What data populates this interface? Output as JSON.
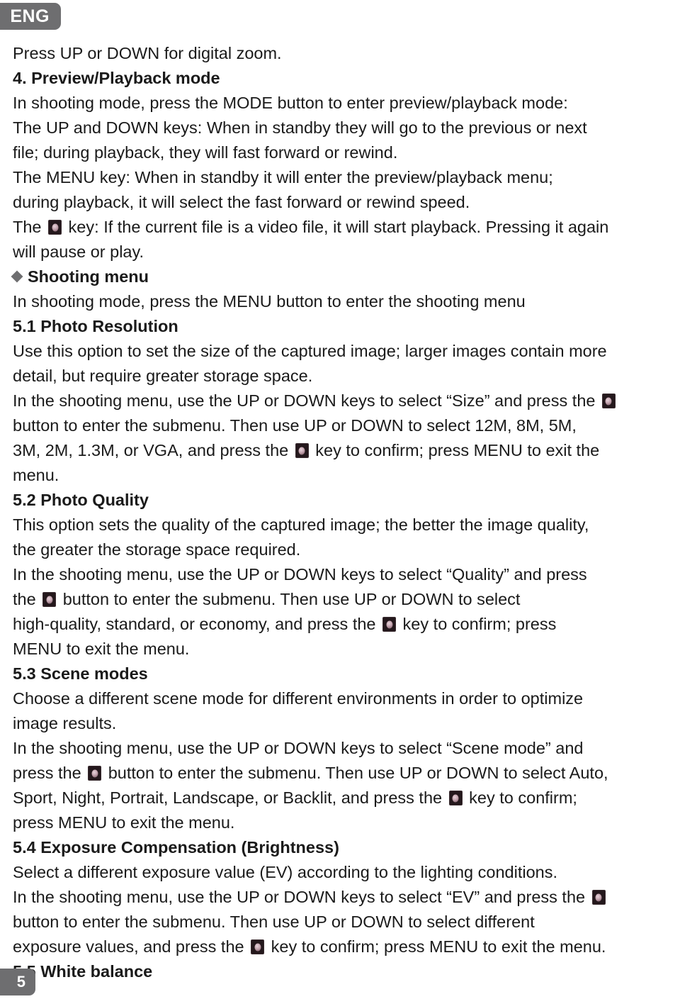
{
  "badges": {
    "language": "ENG",
    "page_number": "5",
    "badge_color": "#6e6e70",
    "badge_text_color": "#ffffff"
  },
  "icons": {
    "key_icon": "camera-shutter-key-icon",
    "bullet_icon": "diamond-bullet-icon"
  },
  "document": {
    "lines": [
      {
        "id": "l1",
        "bold": false,
        "segments": [
          {
            "t": "Press UP or DOWN for digital zoom."
          }
        ]
      },
      {
        "id": "l2",
        "bold": true,
        "segments": [
          {
            "t": "4. Preview/Playback mode"
          }
        ]
      },
      {
        "id": "l3",
        "bold": false,
        "segments": [
          {
            "t": "In shooting mode, press the MODE button to enter preview/playback mode:"
          }
        ]
      },
      {
        "id": "l4",
        "bold": false,
        "segments": [
          {
            "t": "The UP and DOWN keys: When in standby they will go to the previous or next"
          }
        ]
      },
      {
        "id": "l5",
        "bold": false,
        "segments": [
          {
            "t": "file; during playback, they will fast forward or rewind."
          }
        ]
      },
      {
        "id": "l6",
        "bold": false,
        "segments": [
          {
            "t": "The MENU key: When in standby it will enter the preview/playback menu;"
          }
        ]
      },
      {
        "id": "l7",
        "bold": false,
        "segments": [
          {
            "t": "during playback, it will select the fast forward or rewind speed."
          }
        ]
      },
      {
        "id": "l8",
        "bold": false,
        "segments": [
          {
            "t": "The "
          },
          {
            "icon": "key"
          },
          {
            "t": " key: If the current file is a video file, it will start playback. Pressing it again"
          }
        ]
      },
      {
        "id": "l9",
        "bold": false,
        "segments": [
          {
            "t": "will pause or play."
          }
        ]
      },
      {
        "id": "l10",
        "bold": true,
        "segments": [
          {
            "icon": "diamond"
          },
          {
            "t": "Shooting menu"
          }
        ]
      },
      {
        "id": "l11",
        "bold": false,
        "segments": [
          {
            "t": "In shooting mode, press the MENU button to enter the shooting menu"
          }
        ]
      },
      {
        "id": "l12",
        "bold": true,
        "segments": [
          {
            "t": "5.1 Photo Resolution"
          }
        ]
      },
      {
        "id": "l13",
        "bold": false,
        "segments": [
          {
            "t": "Use this option to set the size of the captured image; larger images contain more"
          }
        ]
      },
      {
        "id": "l14",
        "bold": false,
        "segments": [
          {
            "t": "detail, but require greater storage space."
          }
        ]
      },
      {
        "id": "l15",
        "bold": false,
        "segments": [
          {
            "t": "In the shooting menu, use the UP or DOWN keys to select “Size” and press the "
          },
          {
            "icon": "key"
          }
        ]
      },
      {
        "id": "l16",
        "bold": false,
        "segments": [
          {
            "t": "button to enter the submenu. Then use UP or DOWN to select 12M, 8M, 5M,"
          }
        ]
      },
      {
        "id": "l17",
        "bold": false,
        "segments": [
          {
            "t": "3M, 2M, 1.3M, or VGA, and press the "
          },
          {
            "icon": "key"
          },
          {
            "t": " key to confirm; press MENU to exit the"
          }
        ]
      },
      {
        "id": "l18",
        "bold": false,
        "segments": [
          {
            "t": "menu."
          }
        ]
      },
      {
        "id": "l19",
        "bold": true,
        "segments": [
          {
            "t": "5.2 Photo Quality"
          }
        ]
      },
      {
        "id": "l20",
        "bold": false,
        "segments": [
          {
            "t": "This option sets the quality of the captured image; the better the image quality,"
          }
        ]
      },
      {
        "id": "l21",
        "bold": false,
        "segments": [
          {
            "t": "the greater the storage space required."
          }
        ]
      },
      {
        "id": "l22",
        "bold": false,
        "segments": [
          {
            "t": "In the shooting menu, use the UP or DOWN keys to select “Quality” and press"
          }
        ]
      },
      {
        "id": "l23",
        "bold": false,
        "segments": [
          {
            "t": "the "
          },
          {
            "icon": "key"
          },
          {
            "t": " button to enter the submenu. Then use UP or DOWN to select"
          }
        ]
      },
      {
        "id": "l24",
        "bold": false,
        "segments": [
          {
            "t": "high-quality, standard, or economy, and press the "
          },
          {
            "icon": "key"
          },
          {
            "t": " key to confirm; press"
          }
        ]
      },
      {
        "id": "l25",
        "bold": false,
        "segments": [
          {
            "t": "MENU to exit the menu."
          }
        ]
      },
      {
        "id": "l26",
        "bold": true,
        "segments": [
          {
            "t": "5.3 Scene modes"
          }
        ]
      },
      {
        "id": "l27",
        "bold": false,
        "segments": [
          {
            "t": "Choose a different scene mode for different environments in order to optimize"
          }
        ]
      },
      {
        "id": "l28",
        "bold": false,
        "segments": [
          {
            "t": "image results."
          }
        ]
      },
      {
        "id": "l29",
        "bold": false,
        "segments": [
          {
            "t": "In the shooting menu, use the UP or DOWN keys to select “Scene mode” and"
          }
        ]
      },
      {
        "id": "l30",
        "bold": false,
        "segments": [
          {
            "t": "press the "
          },
          {
            "icon": "key"
          },
          {
            "t": " button to enter the submenu. Then use UP or DOWN to select Auto,"
          }
        ]
      },
      {
        "id": "l31",
        "bold": false,
        "segments": [
          {
            "t": "Sport, Night, Portrait, Landscape, or Backlit, and press the "
          },
          {
            "icon": "key"
          },
          {
            "t": " key to confirm;"
          }
        ]
      },
      {
        "id": "l32",
        "bold": false,
        "segments": [
          {
            "t": "press MENU to exit the menu."
          }
        ]
      },
      {
        "id": "l33",
        "bold": true,
        "segments": [
          {
            "t": "5.4 Exposure Compensation (Brightness)"
          }
        ]
      },
      {
        "id": "l34",
        "bold": false,
        "segments": [
          {
            "t": "Select a different exposure value (EV) according to the lighting conditions."
          }
        ]
      },
      {
        "id": "l35",
        "bold": false,
        "segments": [
          {
            "t": "In the shooting menu, use the UP or DOWN keys to select “EV” and press the "
          },
          {
            "icon": "key"
          }
        ]
      },
      {
        "id": "l36",
        "bold": false,
        "segments": [
          {
            "t": "button to enter the submenu. Then use UP or DOWN to select different"
          }
        ]
      },
      {
        "id": "l37",
        "bold": false,
        "segments": [
          {
            "t": "exposure values, and press the "
          },
          {
            "icon": "key"
          },
          {
            "t": " key to confirm; press MENU to exit the menu."
          }
        ]
      },
      {
        "id": "l38",
        "bold": true,
        "segments": [
          {
            "t": "5.5 White balance"
          }
        ]
      }
    ]
  }
}
